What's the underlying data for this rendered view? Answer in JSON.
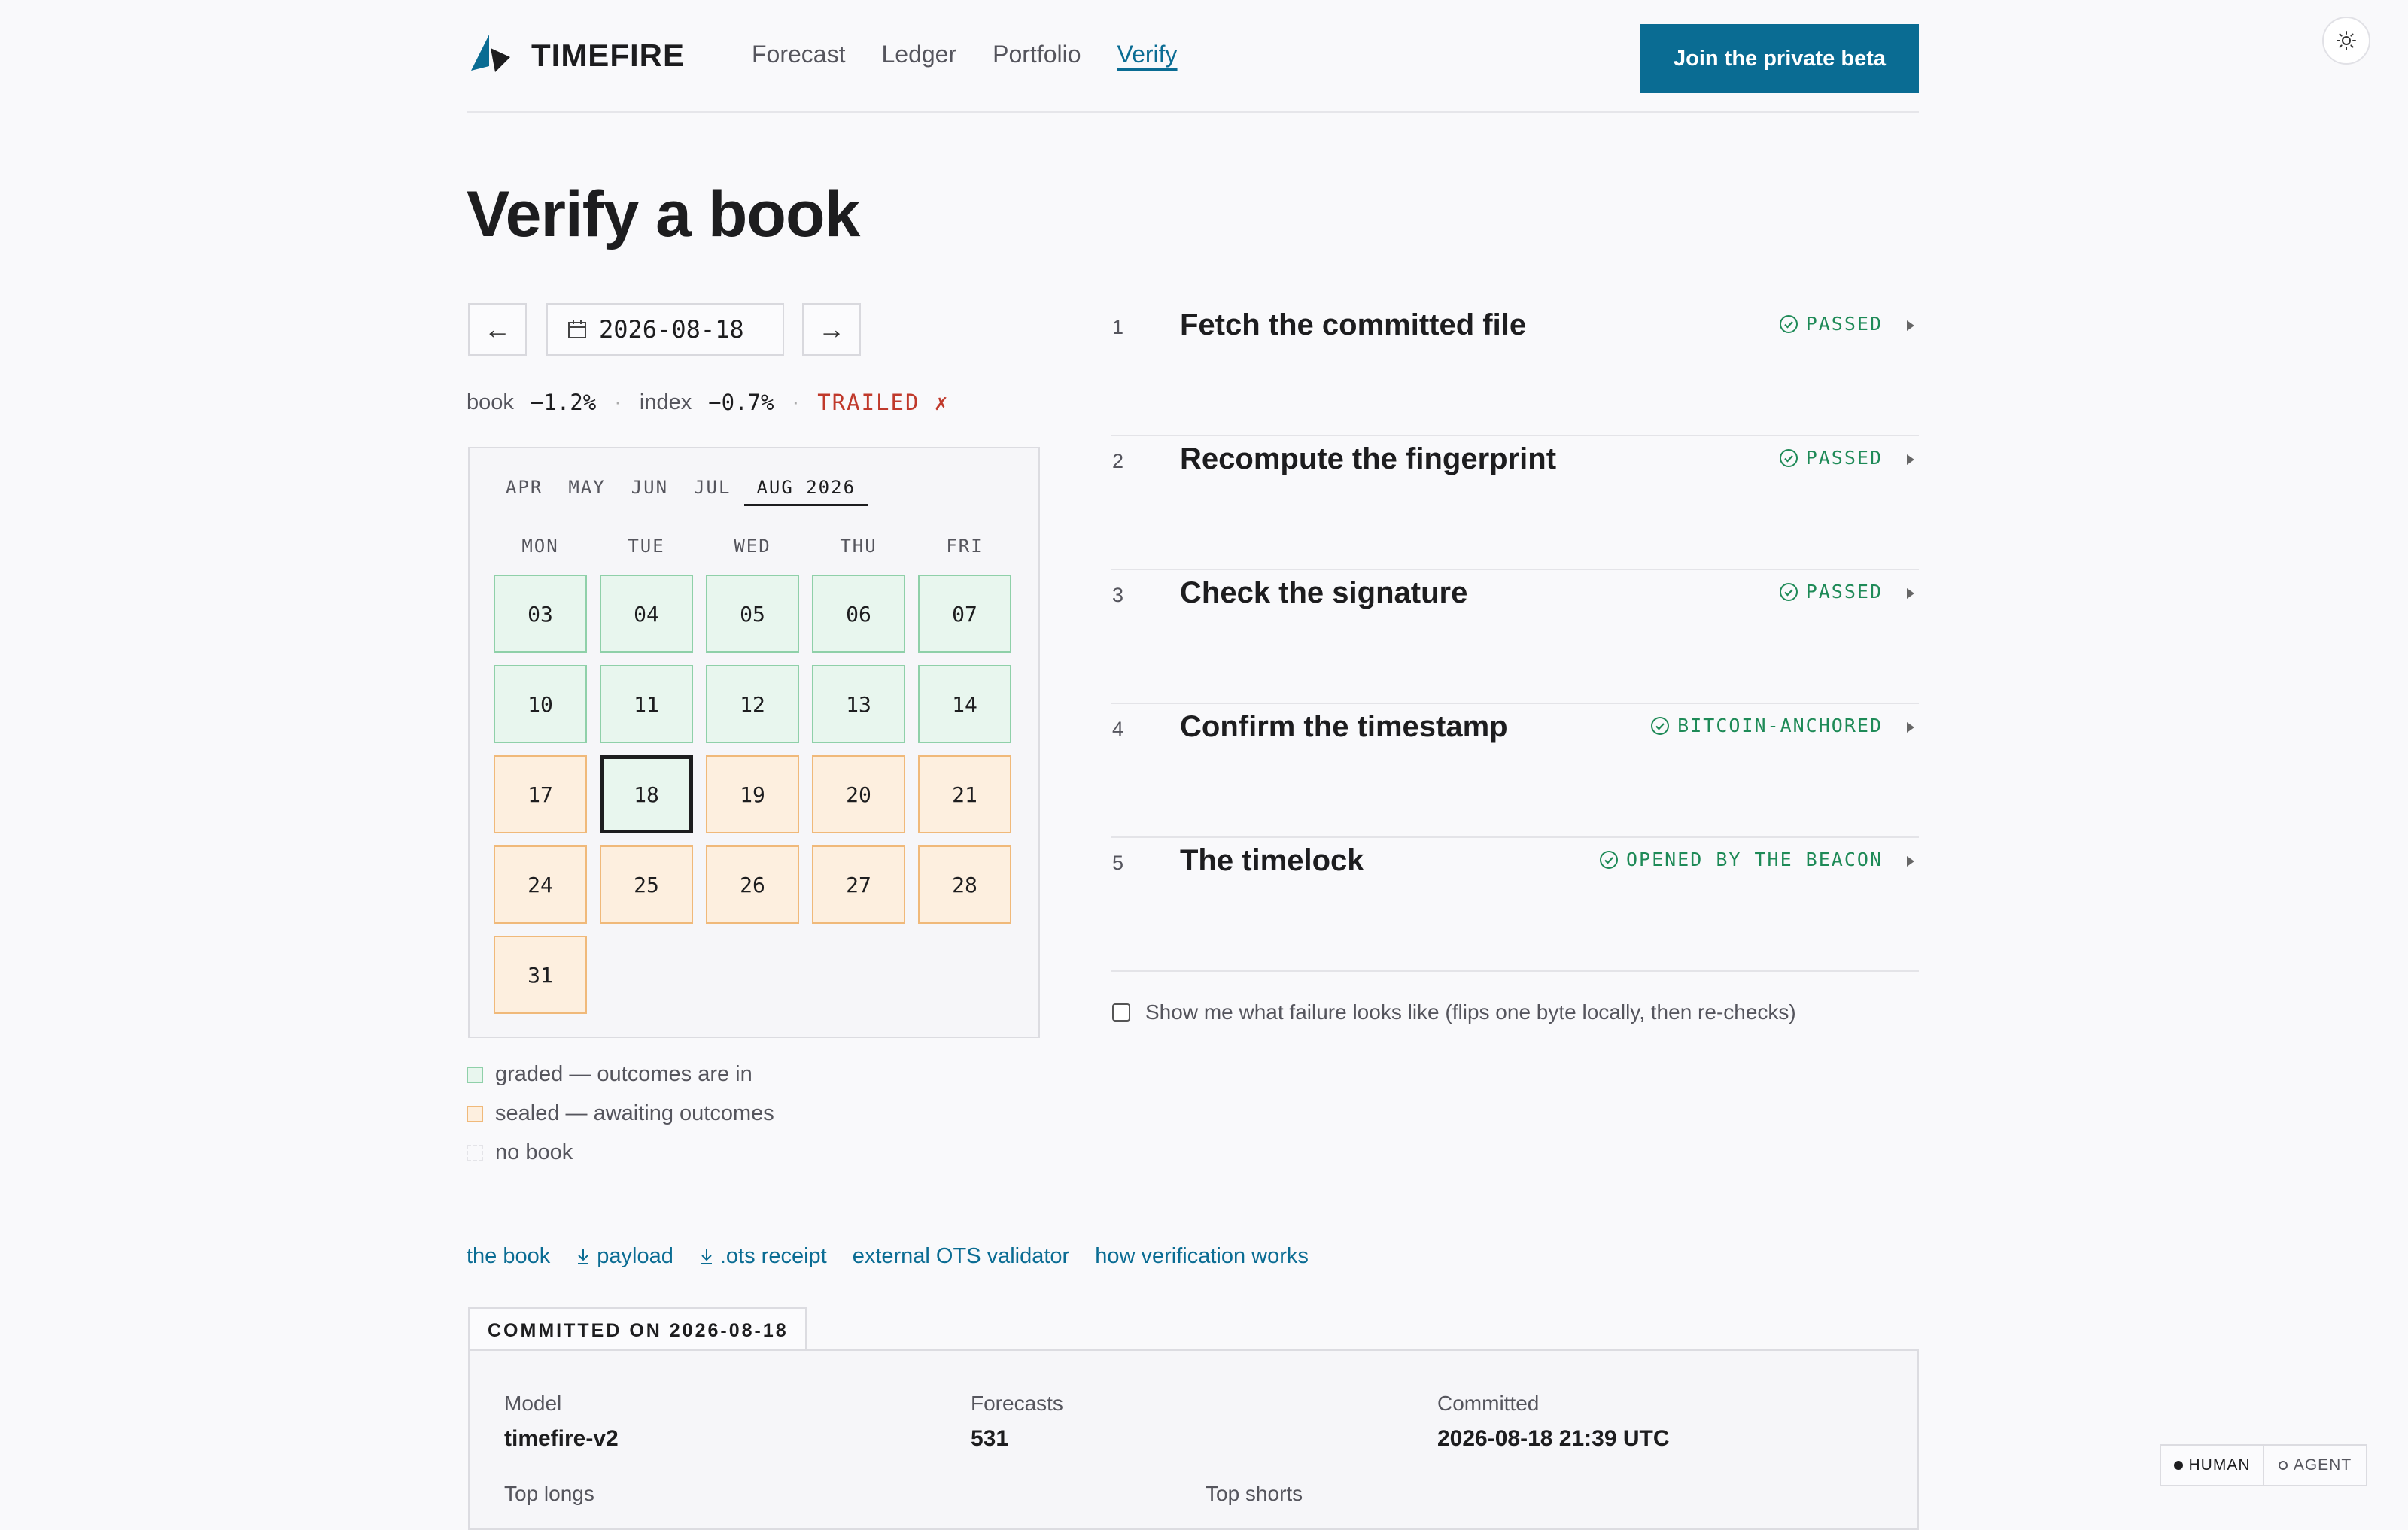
{
  "header": {
    "brand": "TIMEFIRE",
    "nav": [
      {
        "label": "Forecast",
        "active": false
      },
      {
        "label": "Ledger",
        "active": false
      },
      {
        "label": "Portfolio",
        "active": false
      },
      {
        "label": "Verify",
        "active": true
      }
    ],
    "cta_label": "Join the private beta",
    "theme_icon": "sun-icon"
  },
  "page_title": "Verify a book",
  "date_picker": {
    "prev_label": "←",
    "next_label": "→",
    "value": "2026-08-18",
    "icon": "calendar-icon"
  },
  "summary": {
    "book_label": "book",
    "book_value": "−1.2%",
    "sep": "·",
    "index_label": "index",
    "index_value": "−0.7%",
    "result": "TRAILED ✗"
  },
  "calendar": {
    "months": [
      "APR",
      "MAY",
      "JUN",
      "JUL",
      "AUG 2026"
    ],
    "active_month": "AUG 2026",
    "weekdays": [
      "MON",
      "TUE",
      "WED",
      "THU",
      "FRI"
    ],
    "weeks": [
      [
        {
          "d": "03",
          "s": "graded"
        },
        {
          "d": "04",
          "s": "graded"
        },
        {
          "d": "05",
          "s": "graded"
        },
        {
          "d": "06",
          "s": "graded"
        },
        {
          "d": "07",
          "s": "graded"
        }
      ],
      [
        {
          "d": "10",
          "s": "graded"
        },
        {
          "d": "11",
          "s": "graded"
        },
        {
          "d": "12",
          "s": "graded"
        },
        {
          "d": "13",
          "s": "graded"
        },
        {
          "d": "14",
          "s": "graded"
        }
      ],
      [
        {
          "d": "17",
          "s": "sealed"
        },
        {
          "d": "18",
          "s": "graded",
          "selected": true
        },
        {
          "d": "19",
          "s": "sealed"
        },
        {
          "d": "20",
          "s": "sealed"
        },
        {
          "d": "21",
          "s": "sealed"
        }
      ],
      [
        {
          "d": "24",
          "s": "sealed"
        },
        {
          "d": "25",
          "s": "sealed"
        },
        {
          "d": "26",
          "s": "sealed"
        },
        {
          "d": "27",
          "s": "sealed"
        },
        {
          "d": "28",
          "s": "sealed"
        }
      ],
      [
        {
          "d": "31",
          "s": "sealed"
        }
      ]
    ],
    "colors": {
      "graded_bg": "#e8f6ee",
      "graded_border": "#8fd0a9",
      "sealed_bg": "#fdefdf",
      "sealed_border": "#f0b97a"
    }
  },
  "legend": [
    {
      "label": "graded — outcomes are in",
      "kind": "graded"
    },
    {
      "label": "sealed — awaiting outcomes",
      "kind": "sealed"
    },
    {
      "label": "no book",
      "kind": "none"
    }
  ],
  "steps": [
    {
      "num": "1",
      "title": "Fetch the committed file",
      "status": "PASSED"
    },
    {
      "num": "2",
      "title": "Recompute the fingerprint",
      "status": "PASSED"
    },
    {
      "num": "3",
      "title": "Check the signature",
      "status": "PASSED"
    },
    {
      "num": "4",
      "title": "Confirm the timestamp",
      "status": "BITCOIN-ANCHORED"
    },
    {
      "num": "5",
      "title": "The timelock",
      "status": "OPENED BY THE BEACON"
    }
  ],
  "status_color": "#1e8a57",
  "failure_toggle": {
    "checked": false,
    "label": "Show me what failure looks like (flips one byte locally, then re-checks)"
  },
  "links": [
    {
      "label": "the book",
      "icon": ""
    },
    {
      "label": "payload",
      "icon": "download-icon"
    },
    {
      "label": ".ots receipt",
      "icon": "download-icon"
    },
    {
      "label": "external OTS validator",
      "icon": ""
    },
    {
      "label": "how verification works",
      "icon": ""
    }
  ],
  "committed": {
    "tab_label": "COMMITTED ON 2026-08-18",
    "model_label": "Model",
    "model_value": "timefire-v2",
    "forecasts_label": "Forecasts",
    "forecasts_value": "531",
    "committed_label": "Committed",
    "committed_value": "2026-08-18 21:39 UTC",
    "top_longs_label": "Top longs",
    "top_shorts_label": "Top shorts"
  },
  "mode_toggle": {
    "human_label": "HUMAN",
    "agent_label": "AGENT",
    "active": "HUMAN"
  },
  "accent": "#0a6c93"
}
